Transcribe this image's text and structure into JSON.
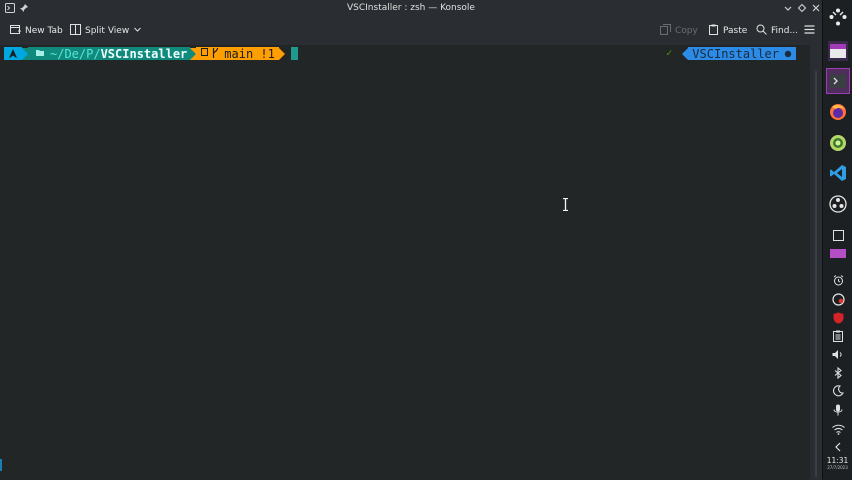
{
  "window": {
    "title": "VSCInstaller : zsh — Konsole"
  },
  "toolbar": {
    "new_tab": "New Tab",
    "split_view": "Split View",
    "copy": "Copy",
    "paste": "Paste",
    "find": "Find..."
  },
  "prompt": {
    "os_icon": "arch-linux-icon",
    "path_prefix": "~/De/P/",
    "path_current": "VSCInstaller",
    "git": "main !1",
    "right_status": "✓",
    "right_dir": "VSCInstaller"
  },
  "tray": {
    "time": "11:31",
    "date": "27/7/2023"
  },
  "colors": {
    "prompt_os_bg": "#00a7e1",
    "prompt_path_bg": "#118a7e",
    "prompt_git_bg": "#ff9e00",
    "prompt_right_bg": "#2b8be6",
    "cursor": "#1f9a8e",
    "terminal_bg": "#232627",
    "chrome_bg": "#2a2e32"
  }
}
